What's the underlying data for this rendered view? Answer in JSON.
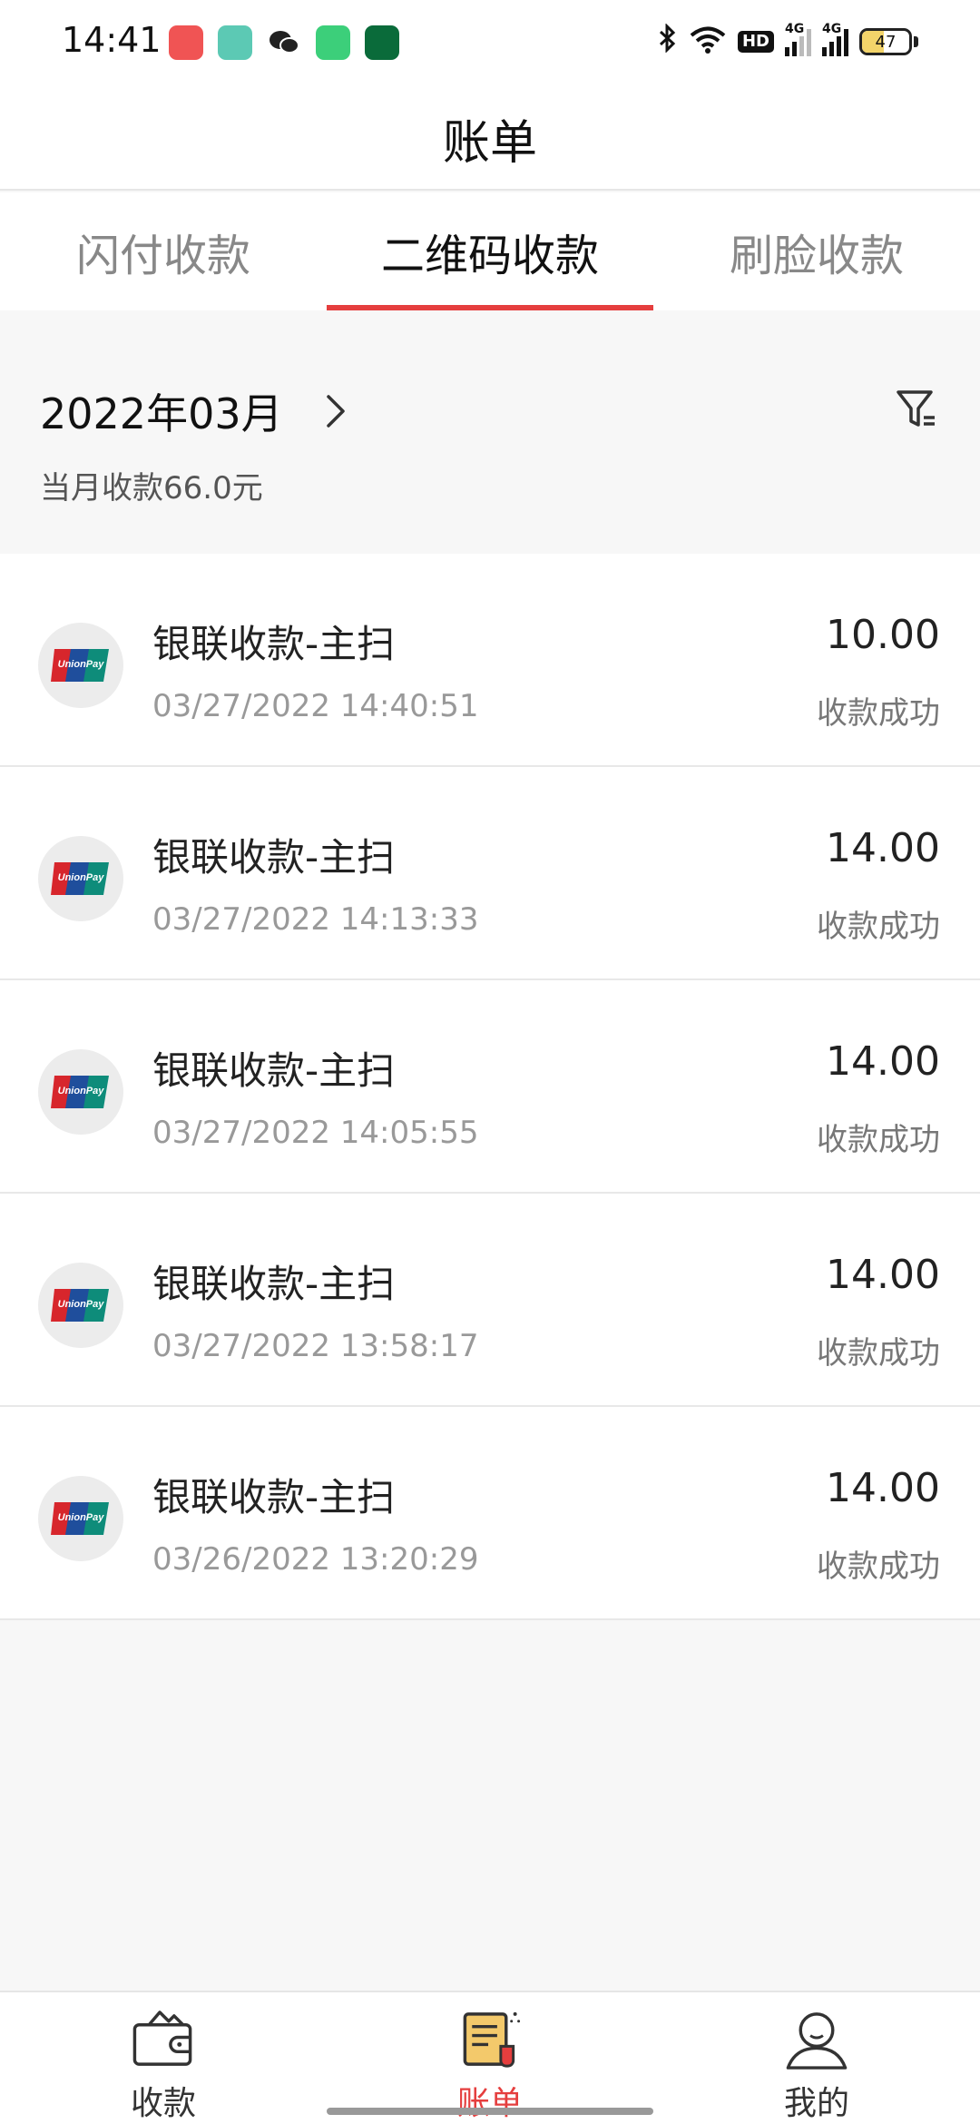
{
  "status_bar": {
    "time": "14:41",
    "battery": "47",
    "battery_level_pct": 47,
    "network_labels": [
      "4G",
      "4G"
    ],
    "hd_label": "HD",
    "icons": [
      "notification-app-icon",
      "app-icon",
      "wechat-icon",
      "market-icon",
      "oppo-icon",
      "bluetooth-icon",
      "wifi-icon",
      "hd-icon",
      "signal-icon",
      "signal-icon",
      "battery-icon"
    ]
  },
  "header": {
    "title": "账单"
  },
  "tabs": [
    {
      "label": "闪付收款",
      "active": false
    },
    {
      "label": "二维码收款",
      "active": true
    },
    {
      "label": "刷脸收款",
      "active": false
    }
  ],
  "month": {
    "label": "2022年03月",
    "total": "当月收款66.0元"
  },
  "transactions": [
    {
      "title": "银联收款-主扫",
      "time": "03/27/2022 14:40:51",
      "amount": "10.00",
      "status": "收款成功"
    },
    {
      "title": "银联收款-主扫",
      "time": "03/27/2022 14:13:33",
      "amount": "14.00",
      "status": "收款成功"
    },
    {
      "title": "银联收款-主扫",
      "time": "03/27/2022 14:05:55",
      "amount": "14.00",
      "status": "收款成功"
    },
    {
      "title": "银联收款-主扫",
      "time": "03/27/2022 13:58:17",
      "amount": "14.00",
      "status": "收款成功"
    },
    {
      "title": "银联收款-主扫",
      "time": "03/26/2022 13:20:29",
      "amount": "14.00",
      "status": "收款成功"
    }
  ],
  "bottom_nav": [
    {
      "label": "收款",
      "icon": "wallet-icon",
      "active": false
    },
    {
      "label": "账单",
      "icon": "bill-icon",
      "active": true
    },
    {
      "label": "我的",
      "icon": "user-icon",
      "active": false
    }
  ],
  "colors": {
    "accent": "#e53e3e",
    "unionpay_red": "#d7262c",
    "unionpay_blue": "#1f4e9c",
    "unionpay_green": "#0e8c7a",
    "bill_icon_yellow": "#f3c96b"
  }
}
